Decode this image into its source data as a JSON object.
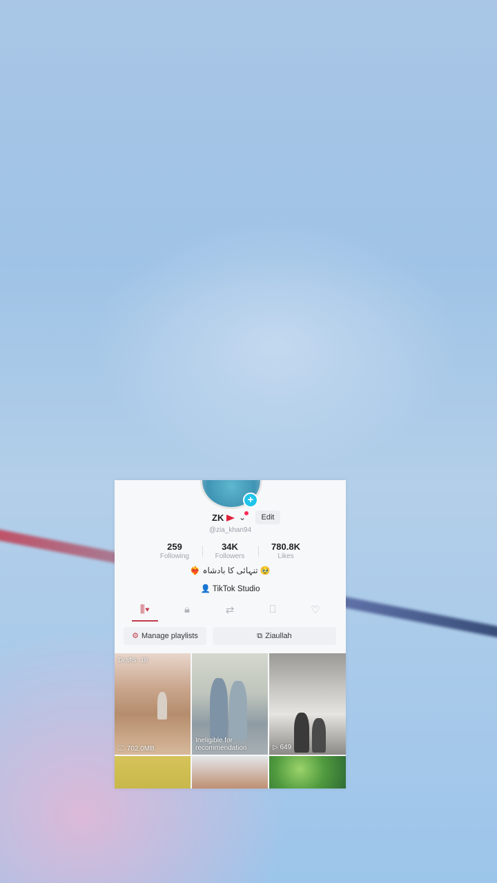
{
  "profile": {
    "name": "ZK",
    "handle": "@zia_khan94",
    "edit_label": "Edit",
    "bio": "❤️‍🔥 تنہائی کا بادشاہ 🥹",
    "studio_label": "TikTok Studio"
  },
  "stats": [
    {
      "value": "259",
      "label": "Following"
    },
    {
      "value": "34K",
      "label": "Followers"
    },
    {
      "value": "780.8K",
      "label": "Likes"
    }
  ],
  "tabs": [
    "videos-icon",
    "lock-icon",
    "repost-icon",
    "bookmark-icon",
    "heart-icon"
  ],
  "buttons": {
    "manage_playlists": "Manage playlists",
    "playlist": "Ziaullah"
  },
  "grid": [
    {
      "top_label": "Drafts: 18",
      "bottom_label": "702.0MB"
    },
    {
      "top_label": "",
      "bottom_label": "Ineligible for recommendation"
    },
    {
      "top_label": "",
      "bottom_label": "649"
    }
  ],
  "colors": {
    "accent": "#c23a4b",
    "plus": "#20c4ea"
  }
}
